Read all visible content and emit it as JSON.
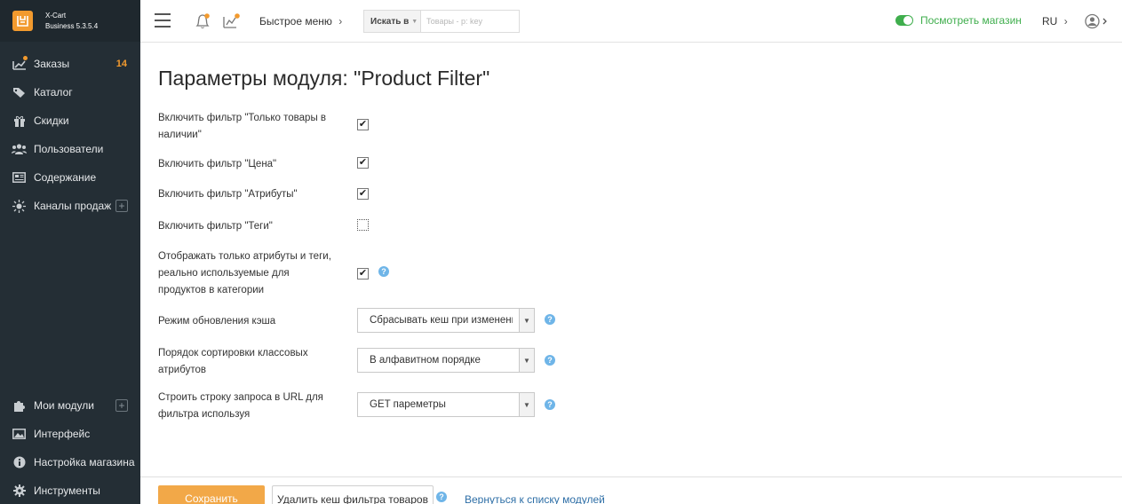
{
  "brand": {
    "name": "X-Cart",
    "edition": "Business 5.3.5.4",
    "logo_icon": "xcart-logo-icon"
  },
  "sidebar": {
    "items": [
      {
        "label": "Заказы",
        "icon": "chart-icon",
        "badge": "14"
      },
      {
        "label": "Каталог",
        "icon": "tag-icon"
      },
      {
        "label": "Скидки",
        "icon": "gift-icon"
      },
      {
        "label": "Пользователи",
        "icon": "users-icon"
      },
      {
        "label": "Содержание",
        "icon": "content-icon"
      },
      {
        "label": "Каналы продаж",
        "icon": "sun-icon",
        "has_plus": true
      }
    ],
    "bottom_items": [
      {
        "label": "Мои модули",
        "icon": "puzzle-icon",
        "has_plus": true
      },
      {
        "label": "Интерфейс",
        "icon": "image-icon"
      },
      {
        "label": "Настройка магазина",
        "icon": "info-icon"
      },
      {
        "label": "Инструменты",
        "icon": "gear-icon"
      }
    ]
  },
  "header": {
    "quick_menu": "Быстрое меню",
    "search_type": "Искать в",
    "search_placeholder": "Товары - р: key",
    "view_store": "Посмотреть магазин",
    "language": "RU"
  },
  "page": {
    "title": "Параметры модуля: \"Product Filter\"",
    "settings": {
      "in_stock": {
        "label": "Включить фильтр \"Только товары в наличии\"",
        "checked": true
      },
      "price": {
        "label": "Включить фильтр \"Цена\"",
        "checked": true
      },
      "attributes": {
        "label": "Включить фильтр \"Атрибуты\"",
        "checked": true
      },
      "tags": {
        "label": "Включить фильтр \"Теги\"",
        "checked": false
      },
      "only_used": {
        "label": "Отображать только атрибуты и теги, реально используемые для продуктов в категории",
        "checked": true
      },
      "cache_mode": {
        "label": "Режим обновления кэша",
        "value": "Сбрасывать кеш при изменении"
      },
      "sort_order": {
        "label": "Порядок сортировки классовых атрибутов",
        "value": "В алфавитном порядке"
      },
      "url_mode": {
        "label": "Строить строку запроса в URL для фильтра используя",
        "value": "GET пареметры"
      }
    }
  },
  "footer": {
    "save": "Сохранить",
    "clear_cache": "Удалить кеш фильтра товаров",
    "back_link": "Вернуться к списку модулей"
  },
  "colors": {
    "accent": "#f29a2e",
    "sidebar_bg": "#242e35",
    "green": "#3fae4d",
    "link": "#2d6ea6",
    "help": "#6fb5e8"
  }
}
